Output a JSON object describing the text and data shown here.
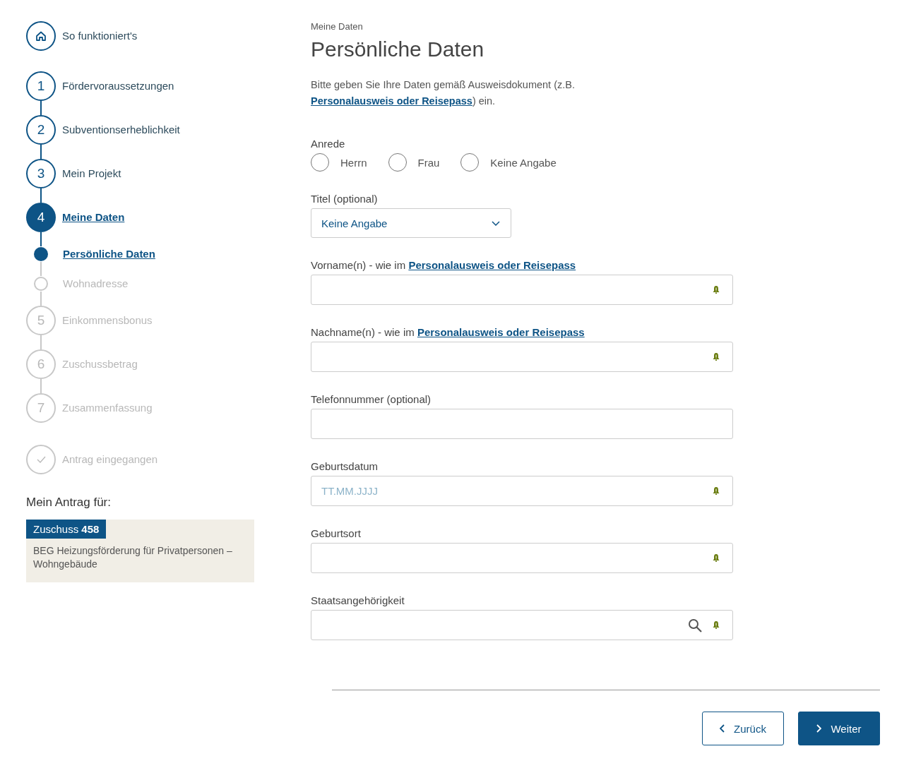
{
  "steps": [
    {
      "kind": "home",
      "label": "So funktioniert's",
      "selected": false,
      "disabled": false
    },
    {
      "kind": "number",
      "number": "1",
      "label": "Fördervoraussetzungen",
      "selected": false,
      "disabled": false
    },
    {
      "kind": "number",
      "number": "2",
      "label": "Subventionserheblichkeit",
      "selected": false,
      "disabled": false
    },
    {
      "kind": "number",
      "number": "3",
      "label": "Mein Projekt",
      "selected": false,
      "disabled": false
    },
    {
      "kind": "number",
      "number": "4",
      "label": "Meine Daten",
      "selected": true,
      "disabled": false,
      "children": [
        {
          "kind": "sub",
          "label": "Persönliche Daten",
          "selected": true,
          "disabled": false
        },
        {
          "kind": "sub",
          "label": "Wohnadresse",
          "selected": false,
          "disabled": true
        }
      ]
    },
    {
      "kind": "number",
      "number": "5",
      "label": "Einkommensbonus",
      "selected": false,
      "disabled": true
    },
    {
      "kind": "number",
      "number": "6",
      "label": "Zuschussbetrag",
      "selected": false,
      "disabled": true
    },
    {
      "kind": "number",
      "number": "7",
      "label": "Zusammenfassung",
      "selected": false,
      "disabled": true
    },
    {
      "kind": "check",
      "label": "Antrag eingegangen",
      "selected": false,
      "disabled": true
    }
  ],
  "application": {
    "heading": "Mein Antrag für:",
    "badge_label": "Zuschuss",
    "badge_number": "458",
    "title": "BEG Heizungsförderung für Privatpersonen – Wohngebäude"
  },
  "breadcrumb": "Meine Daten",
  "title": "Persönliche Daten",
  "intro": {
    "before": "Bitte geben Sie Ihre Daten gemäß Ausweisdokument (z.B.",
    "link": "Personalausweis oder Reisepass",
    "after": ") ein."
  },
  "salutation": {
    "label": "Anrede",
    "options": [
      {
        "label": "Herrn",
        "selected": false
      },
      {
        "label": "Frau",
        "selected": false
      },
      {
        "label": "Keine Angabe",
        "selected": false
      }
    ]
  },
  "title_select": {
    "label": "Titel (optional)",
    "value": "Keine Angabe"
  },
  "fields": [
    {
      "kind": "text",
      "label": "Vorname(n) - wie im",
      "link": "Personalausweis oder Reisepass",
      "required": true
    },
    {
      "kind": "text",
      "label": "Nachname(n) - wie im",
      "link": "Personalausweis oder Reisepass",
      "required": true
    },
    {
      "kind": "text",
      "label": "Telefonnummer (optional)",
      "required": false
    },
    {
      "kind": "text",
      "label": "Geburtsdatum",
      "placeholder": "TT.MM.JJJJ",
      "required": true
    },
    {
      "kind": "text",
      "label": "Geburtsort",
      "required": true
    },
    {
      "kind": "search",
      "label": "Staatsangehörigkeit",
      "required": true
    }
  ],
  "buttons": [
    {
      "kind": "back",
      "label": "Zurück"
    },
    {
      "kind": "next",
      "label": "Weiter"
    }
  ]
}
